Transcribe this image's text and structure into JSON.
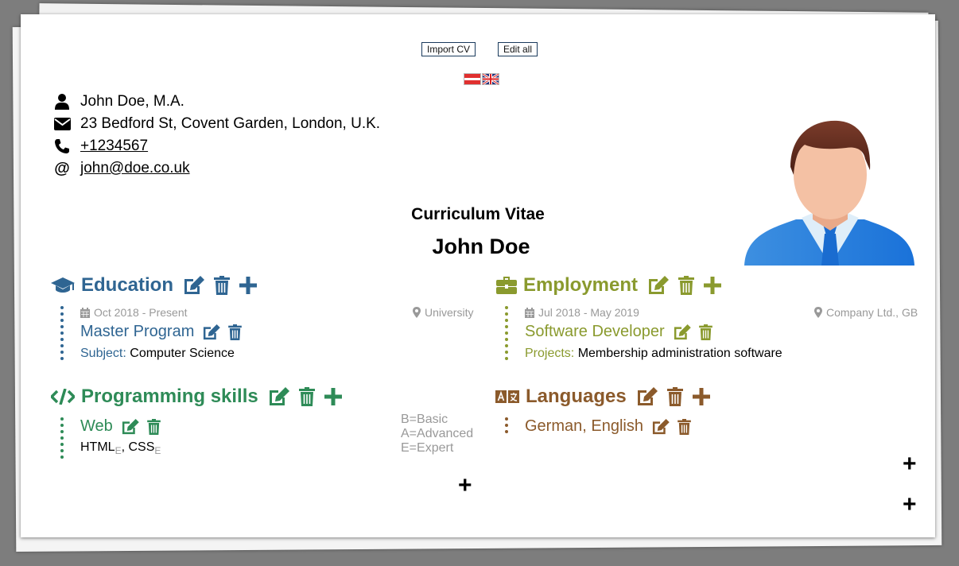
{
  "toolbar": {
    "import_label": "Import CV",
    "edit_all_label": "Edit all"
  },
  "languages_switch": [
    "flag-austria",
    "flag-uk"
  ],
  "contact": {
    "name": "John Doe, M.A.",
    "address": "23 Bedford St, Covent Garden, London, U.K.",
    "phone": "+1234567",
    "email": "john@doe.co.uk"
  },
  "header": {
    "subtitle": "Curriculum Vitae",
    "name": "John Doe"
  },
  "colors": {
    "education": "#2f6592",
    "employment": "#8a9a2e",
    "skills": "#2e8b57",
    "languages": "#8b5a2b"
  },
  "education": {
    "title": "Education",
    "entries": [
      {
        "date": "Oct 2018 - Present",
        "place": "University",
        "title": "Master Program",
        "detail_label": "Subject:",
        "detail_value": "Computer Science"
      }
    ]
  },
  "employment": {
    "title": "Employment",
    "entries": [
      {
        "date": "Jul 2018 - May 2019",
        "place": "Company Ltd., GB",
        "title": "Software Developer",
        "detail_label": "Projects:",
        "detail_value": "Membership administration software"
      }
    ]
  },
  "skills": {
    "title": "Programming skills",
    "entries": [
      {
        "title": "Web",
        "items": [
          {
            "name": "HTML",
            "level": "E"
          },
          {
            "name": "CSS",
            "level": "E"
          }
        ]
      }
    ],
    "legend": [
      "B=Basic",
      "A=Advanced",
      "E=Expert"
    ]
  },
  "languages": {
    "title": "Languages",
    "entries": [
      {
        "title": "German, English"
      }
    ]
  },
  "add_section_symbols": [
    "+",
    "+",
    "+"
  ]
}
